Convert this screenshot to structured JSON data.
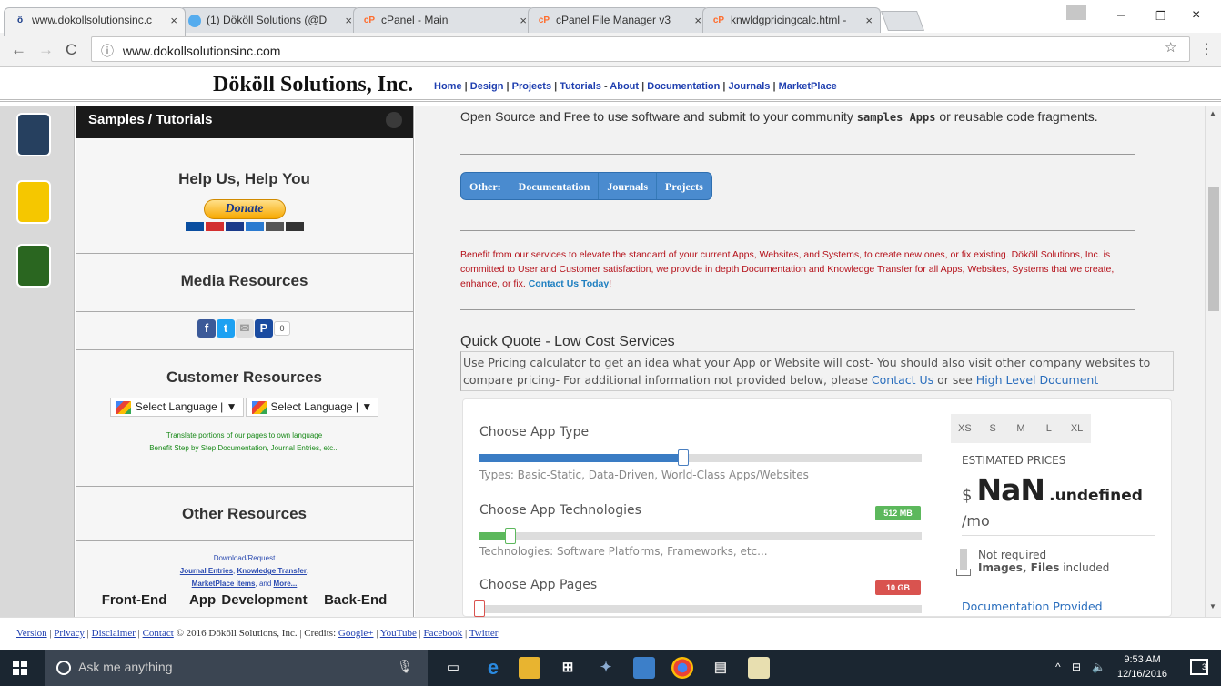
{
  "browser": {
    "tabs": [
      {
        "title": "www.dokollsolutionsinc.c",
        "icon": "ö"
      },
      {
        "title": "(1) Dököll Solutions (@D",
        "icon": "twitter"
      },
      {
        "title": "cPanel - Main",
        "icon": "cP"
      },
      {
        "title": "cPanel File Manager v3",
        "icon": "cP"
      },
      {
        "title": "knwldgpricingcalc.html -",
        "icon": "cP"
      }
    ],
    "tab_close": "×",
    "url": "www.dokollsolutionsinc.com",
    "win_minimize": "–",
    "win_maximize": "❐",
    "win_close": "×"
  },
  "site": {
    "brand": "Dököll Solutions, Inc.",
    "nav": [
      "Home",
      "Design",
      "Projects",
      "Tutorials",
      "About",
      "Documentation",
      "Journals",
      "MarketPlace"
    ]
  },
  "sidebar": {
    "header": "Samples / Tutorials",
    "help_title": "Help Us, Help You",
    "donate_label": "Donate",
    "media_title": "Media Resources",
    "share_count": "0",
    "customer_title": "Customer Resources",
    "select_language": "Select Language",
    "translate_line1": "Translate portions of our pages to own language",
    "translate_line2": "Benefit Step by Step Documentation, Journal Entries, etc...",
    "other_title": "Other Resources",
    "download": "Download/Request",
    "journal_entries": "Journal Entries",
    "knowledge_transfer": "Knowledge Transfer",
    "marketplace_items": "MarketPlace items",
    "and": ", and",
    "more": "More...",
    "bottom_row": [
      "Front-End",
      "App Development",
      "Back-End"
    ]
  },
  "main": {
    "intro_pre": "Open Source and Free to use software and submit to your community",
    "intro_code": "samples Apps",
    "intro_post": "or reusable code fragments.",
    "pills": [
      "Other:",
      "Documentation",
      "Journals",
      "Projects"
    ],
    "red_text": "Benefit from our services to elevate the standard of your current Apps, Websites, and Systems, to create new ones, or fix existing. Dököll Solutions, Inc. is committed to User and Customer satisfaction, we provide in depth Documentation and Knowledge Transfer for all Apps, Websites, Systems that we create, enhance, or fix.",
    "contact_today": "Contact Us Today",
    "quick_quote_title": "Quick Quote - Low Cost Services",
    "qq_desc_pre": "Use Pricing calculator to get an idea what your App or Website will cost- You should also visit other company websites to compare pricing- For additional information not provided below, please",
    "qq_contact": "Contact Us",
    "qq_or_see": "or see",
    "qq_doc": "High Level Document"
  },
  "calculator": {
    "app_type_label": "Choose App Type",
    "app_type_hint": "Types: Basic-Static, Data-Driven, World-Class Apps/Websites",
    "app_type_level": 0.46,
    "tech_label": "Choose App Technologies",
    "tech_badge": "512 MB",
    "tech_hint": "Technologies: Software Platforms, Frameworks, etc...",
    "tech_level": 0.07,
    "pages_label": "Choose App Pages",
    "pages_badge": "10 GB",
    "sizes": [
      "XS",
      "S",
      "M",
      "L",
      "XL"
    ],
    "estimated_label": "ESTIMATED PRICES",
    "currency": "$",
    "price_value": "NaN",
    "price_decimal": ".undefined",
    "per_month": "/mo",
    "not_required": "Not required",
    "images_files": "Images, Files",
    "included": "included",
    "documentation_provided": "Documentation Provided",
    "accent_blue": "#3a7cc4",
    "accent_green": "#5cb85c",
    "accent_red": "#d9534f"
  },
  "footer": {
    "links_a": [
      "Version",
      "Privacy",
      "Disclaimer",
      "Contact"
    ],
    "copyright": "© 2016 Dököll Solutions, Inc. | Credits:",
    "links_b": [
      "Google+",
      "YouTube",
      "Facebook",
      "Twitter"
    ]
  },
  "taskbar": {
    "search_placeholder": "Ask me anything",
    "time": "9:53 AM",
    "date": "12/16/2016",
    "notifications": "3"
  }
}
